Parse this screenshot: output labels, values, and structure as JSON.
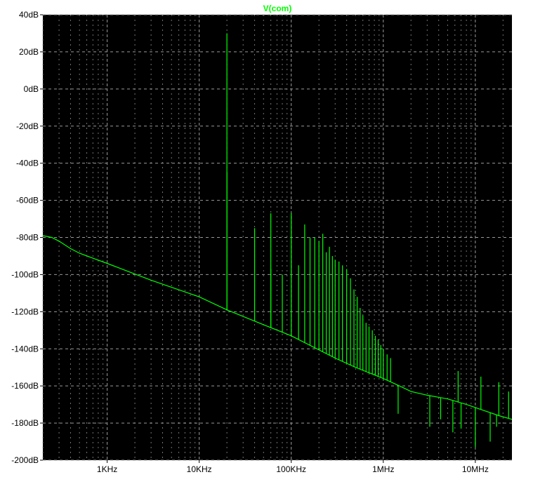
{
  "colors": {
    "background": "#000000",
    "trace": "#00ff00",
    "grid": "#9a9a9a",
    "labels": "#000000",
    "frame": "#ffffff"
  },
  "chart_data": {
    "type": "line",
    "title": "V(com)",
    "xscale": "log",
    "xlim": [
      200,
      25000000
    ],
    "ylim": [
      -200,
      40
    ],
    "x_ticks": [
      {
        "value": 1000,
        "label": "1KHz"
      },
      {
        "value": 10000,
        "label": "10KHz"
      },
      {
        "value": 100000,
        "label": "100KHz"
      },
      {
        "value": 1000000,
        "label": "1MHz"
      },
      {
        "value": 10000000,
        "label": "10MHz"
      }
    ],
    "y_ticks": [
      {
        "value": 40,
        "label": "40dB"
      },
      {
        "value": 20,
        "label": "20dB"
      },
      {
        "value": 0,
        "label": "0dB"
      },
      {
        "value": -20,
        "label": "-20dB"
      },
      {
        "value": -40,
        "label": "-40dB"
      },
      {
        "value": -60,
        "label": "-60dB"
      },
      {
        "value": -80,
        "label": "-80dB"
      },
      {
        "value": -100,
        "label": "-100dB"
      },
      {
        "value": -120,
        "label": "-120dB"
      },
      {
        "value": -140,
        "label": "-140dB"
      },
      {
        "value": -160,
        "label": "-160dB"
      },
      {
        "value": -180,
        "label": "-180dB"
      },
      {
        "value": -200,
        "label": "-200dB"
      }
    ],
    "grid": true,
    "series": [
      {
        "name": "V(com)",
        "floor": [
          [
            200,
            -79
          ],
          [
            250,
            -80
          ],
          [
            300,
            -82
          ],
          [
            400,
            -86
          ],
          [
            500,
            -88.5
          ],
          [
            1000,
            -94
          ],
          [
            3000,
            -103
          ],
          [
            10000,
            -112
          ],
          [
            20000,
            -119
          ],
          [
            50000,
            -127
          ],
          [
            100000,
            -133
          ],
          [
            300000,
            -145
          ],
          [
            500000,
            -150
          ],
          [
            1000000,
            -156
          ],
          [
            1500000,
            -160
          ],
          [
            2000000,
            -163
          ],
          [
            3000000,
            -165
          ],
          [
            5000000,
            -167
          ],
          [
            8000000,
            -170
          ],
          [
            12000000,
            -173
          ],
          [
            18000000,
            -176
          ],
          [
            25000000,
            -178
          ]
        ],
        "peaks": [
          [
            20000,
            30
          ],
          [
            20000,
            -45
          ],
          [
            40000,
            -75
          ],
          [
            60000,
            -67
          ],
          [
            60000,
            -97
          ],
          [
            80000,
            -100
          ],
          [
            100000,
            -67
          ],
          [
            120000,
            -95
          ],
          [
            140000,
            -73
          ],
          [
            160000,
            -80
          ],
          [
            180000,
            -80
          ],
          [
            200000,
            -82
          ],
          [
            220000,
            -78
          ],
          [
            240000,
            -88
          ],
          [
            260000,
            -85
          ],
          [
            280000,
            -90
          ],
          [
            300000,
            -92
          ],
          [
            330000,
            -93
          ],
          [
            360000,
            -95
          ],
          [
            400000,
            -97
          ],
          [
            440000,
            -102
          ],
          [
            480000,
            -108
          ],
          [
            520000,
            -112
          ],
          [
            560000,
            -118
          ],
          [
            600000,
            -122
          ],
          [
            650000,
            -126
          ],
          [
            700000,
            -128
          ],
          [
            760000,
            -130
          ],
          [
            820000,
            -133
          ],
          [
            880000,
            -135
          ],
          [
            940000,
            -138
          ],
          [
            1000000,
            -140
          ],
          [
            1100000,
            -143
          ],
          [
            1200000,
            -145
          ],
          [
            6500000,
            -152
          ],
          [
            11500000,
            -155
          ],
          [
            18000000,
            -158
          ],
          [
            23000000,
            -163
          ]
        ],
        "dips": [
          [
            1450000,
            -175
          ],
          [
            3200000,
            -182
          ],
          [
            4200000,
            -178
          ],
          [
            5700000,
            -185
          ],
          [
            7000000,
            -183
          ],
          [
            10000000,
            -193
          ],
          [
            14500000,
            -190
          ],
          [
            17000000,
            -182
          ]
        ]
      }
    ]
  }
}
